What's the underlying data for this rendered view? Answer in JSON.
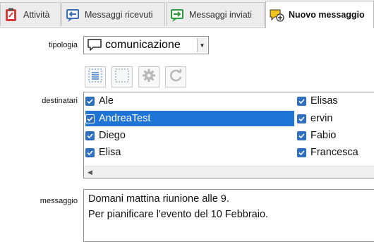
{
  "tabs": [
    {
      "label": "Attività",
      "icon": "activity-clipboard-icon",
      "active": false
    },
    {
      "label": "Messaggi ricevuti",
      "icon": "inbox-arrow-icon",
      "active": false
    },
    {
      "label": "Messaggi inviati",
      "icon": "outbox-arrow-icon",
      "active": false
    },
    {
      "label": "Nuovo messaggio",
      "icon": "new-message-icon",
      "active": true
    }
  ],
  "form": {
    "tipologia_label": "tipologia",
    "tipologia_value": "comunicazione",
    "destinatari_label": "destinatari",
    "messaggio_label": "messaggio"
  },
  "toolbar": [
    "select-all-icon",
    "select-none-icon",
    "settings-gear-icon",
    "refresh-icon"
  ],
  "recipients": {
    "left": [
      {
        "name": "Ale",
        "checked": true,
        "selected": false
      },
      {
        "name": "AndreaTest",
        "checked": true,
        "selected": true
      },
      {
        "name": "Diego",
        "checked": true,
        "selected": false
      },
      {
        "name": "Elisa",
        "checked": true,
        "selected": false
      }
    ],
    "right": [
      {
        "name": "Elisas",
        "checked": true,
        "selected": false
      },
      {
        "name": "ervin",
        "checked": true,
        "selected": false
      },
      {
        "name": "Fabio",
        "checked": true,
        "selected": false
      },
      {
        "name": "Francesca",
        "checked": true,
        "selected": false
      }
    ]
  },
  "message": {
    "line1": "Domani mattina riunione alle 9.",
    "line2": "Per pianificare l'evento del 10 Febbraio."
  },
  "colors": {
    "checkbox": "#2f6fc0",
    "selection": "#1e75d6"
  }
}
